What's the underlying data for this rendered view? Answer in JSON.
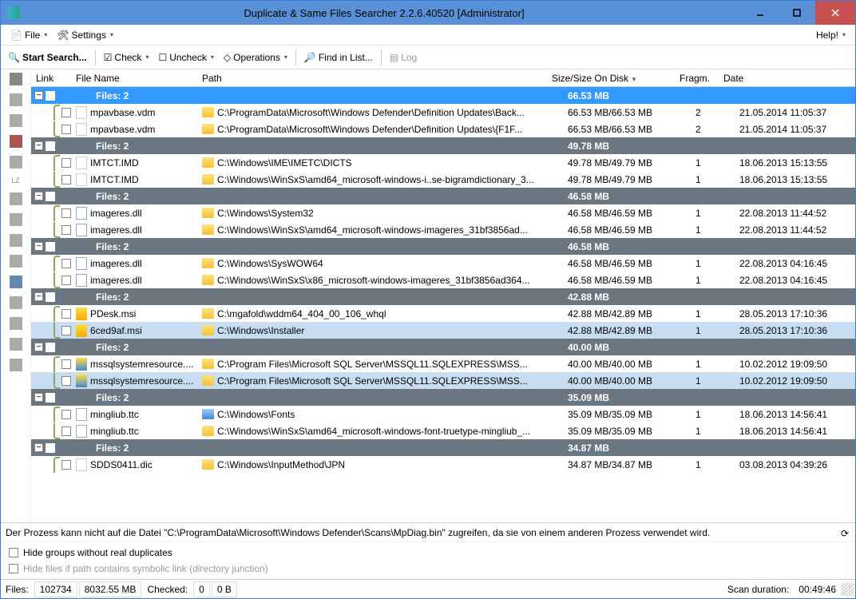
{
  "window": {
    "title": "Duplicate & Same Files Searcher 2.2.6.40520 [Administrator]"
  },
  "menubar": {
    "file": "File",
    "settings": "Settings",
    "help": "Help!"
  },
  "toolbar": {
    "start_search": "Start Search...",
    "check": "Check",
    "uncheck": "Uncheck",
    "operations": "Operations",
    "find_in_list": "Find in List...",
    "log": "Log"
  },
  "columns": {
    "link": "Link",
    "filename": "File Name",
    "path": "Path",
    "size": "Size/Size On Disk",
    "fragm": "Fragm.",
    "date": "Date"
  },
  "groups": [
    {
      "label": "Files: 2",
      "size": "66.53 MB",
      "selected": true,
      "files": [
        {
          "name": "mpavbase.vdm",
          "path": "C:\\ProgramData\\Microsoft\\Windows Defender\\Definition Updates\\Back...",
          "size": "66.53 MB/66.53 MB",
          "frag": "2",
          "date": "21.05.2014 11:05:37",
          "ico": "file"
        },
        {
          "name": "mpavbase.vdm",
          "path": "C:\\ProgramData\\Microsoft\\Windows Defender\\Definition Updates\\{F1F...",
          "size": "66.53 MB/66.53 MB",
          "frag": "2",
          "date": "21.05.2014 11:05:37",
          "ico": "file"
        }
      ]
    },
    {
      "label": "Files: 2",
      "size": "49.78 MB",
      "files": [
        {
          "name": "IMTCT.IMD",
          "path": "C:\\Windows\\IME\\IMETC\\DICTS",
          "size": "49.78 MB/49.79 MB",
          "frag": "1",
          "date": "18.06.2013 15:13:55",
          "ico": "file"
        },
        {
          "name": "IMTCT.IMD",
          "path": "C:\\Windows\\WinSxS\\amd64_microsoft-windows-i..se-bigramdictionary_3...",
          "size": "49.78 MB/49.79 MB",
          "frag": "1",
          "date": "18.06.2013 15:13:55",
          "ico": "file"
        }
      ]
    },
    {
      "label": "Files: 2",
      "size": "46.58 MB",
      "files": [
        {
          "name": "imageres.dll",
          "path": "C:\\Windows\\System32",
          "size": "46.58 MB/46.59 MB",
          "frag": "1",
          "date": "22.08.2013 11:44:52",
          "ico": "dll"
        },
        {
          "name": "imageres.dll",
          "path": "C:\\Windows\\WinSxS\\amd64_microsoft-windows-imageres_31bf3856ad...",
          "size": "46.58 MB/46.59 MB",
          "frag": "1",
          "date": "22.08.2013 11:44:52",
          "ico": "dll"
        }
      ]
    },
    {
      "label": "Files: 2",
      "size": "46.58 MB",
      "files": [
        {
          "name": "imageres.dll",
          "path": "C:\\Windows\\SysWOW64",
          "size": "46.58 MB/46.59 MB",
          "frag": "1",
          "date": "22.08.2013 04:16:45",
          "ico": "dll"
        },
        {
          "name": "imageres.dll",
          "path": "C:\\Windows\\WinSxS\\x86_microsoft-windows-imageres_31bf3856ad364...",
          "size": "46.58 MB/46.59 MB",
          "frag": "1",
          "date": "22.08.2013 04:16:45",
          "ico": "dll"
        }
      ]
    },
    {
      "label": "Files: 2",
      "size": "42.88 MB",
      "files": [
        {
          "name": "PDesk.msi",
          "path": "C:\\mgafold\\wddm64_404_00_106_whql",
          "size": "42.88 MB/42.89 MB",
          "frag": "1",
          "date": "28.05.2013 17:10:36",
          "ico": "msi"
        },
        {
          "name": "6ced9af.msi",
          "path": "C:\\Windows\\Installer",
          "size": "42.88 MB/42.89 MB",
          "frag": "1",
          "date": "28.05.2013 17:10:36",
          "ico": "msi",
          "sel": true
        }
      ]
    },
    {
      "label": "Files: 2",
      "size": "40.00 MB",
      "files": [
        {
          "name": "mssqlsystemresource....",
          "path": "C:\\Program Files\\Microsoft SQL Server\\MSSQL11.SQLEXPRESS\\MSS...",
          "size": "40.00 MB/40.00 MB",
          "frag": "1",
          "date": "10.02.2012 19:09:50",
          "ico": "mdf"
        },
        {
          "name": "mssqlsystemresource....",
          "path": "C:\\Program Files\\Microsoft SQL Server\\MSSQL11.SQLEXPRESS\\MSS...",
          "size": "40.00 MB/40.00 MB",
          "frag": "1",
          "date": "10.02.2012 19:09:50",
          "ico": "mdf",
          "sel": true
        }
      ]
    },
    {
      "label": "Files: 2",
      "size": "35.09 MB",
      "files": [
        {
          "name": "mingliub.ttc",
          "path": "C:\\Windows\\Fonts",
          "size": "35.09 MB/35.09 MB",
          "frag": "1",
          "date": "18.06.2013 14:56:41",
          "ico": "a",
          "fblue": true
        },
        {
          "name": "mingliub.ttc",
          "path": "C:\\Windows\\WinSxS\\amd64_microsoft-windows-font-truetype-mingliub_...",
          "size": "35.09 MB/35.09 MB",
          "frag": "1",
          "date": "18.06.2013 14:56:41",
          "ico": "a"
        }
      ]
    },
    {
      "label": "Files: 2",
      "size": "34.87 MB",
      "files": [
        {
          "name": "SDDS0411.dic",
          "path": "C:\\Windows\\InputMethod\\JPN",
          "size": "34.87 MB/34.87 MB",
          "frag": "1",
          "date": "03.08.2013 04:39:26",
          "ico": "file"
        }
      ]
    }
  ],
  "message": "Der Prozess kann nicht auf die Datei \"C:\\ProgramData\\Microsoft\\Windows Defender\\Scans\\MpDiag.bin\" zugreifen, da sie von einem anderen Prozess verwendet wird.",
  "options": {
    "hide_groups": "Hide groups without real duplicates",
    "hide_symbolic": "Hide files if path contains symbolic link (directory junction)"
  },
  "status": {
    "files_label": "Files:",
    "files_count": "102734",
    "files_size": "8032.55 MB",
    "checked_label": "Checked:",
    "checked_count": "0",
    "checked_size": "0 B",
    "scan_label": "Scan duration:",
    "scan_time": "00:49:46"
  }
}
